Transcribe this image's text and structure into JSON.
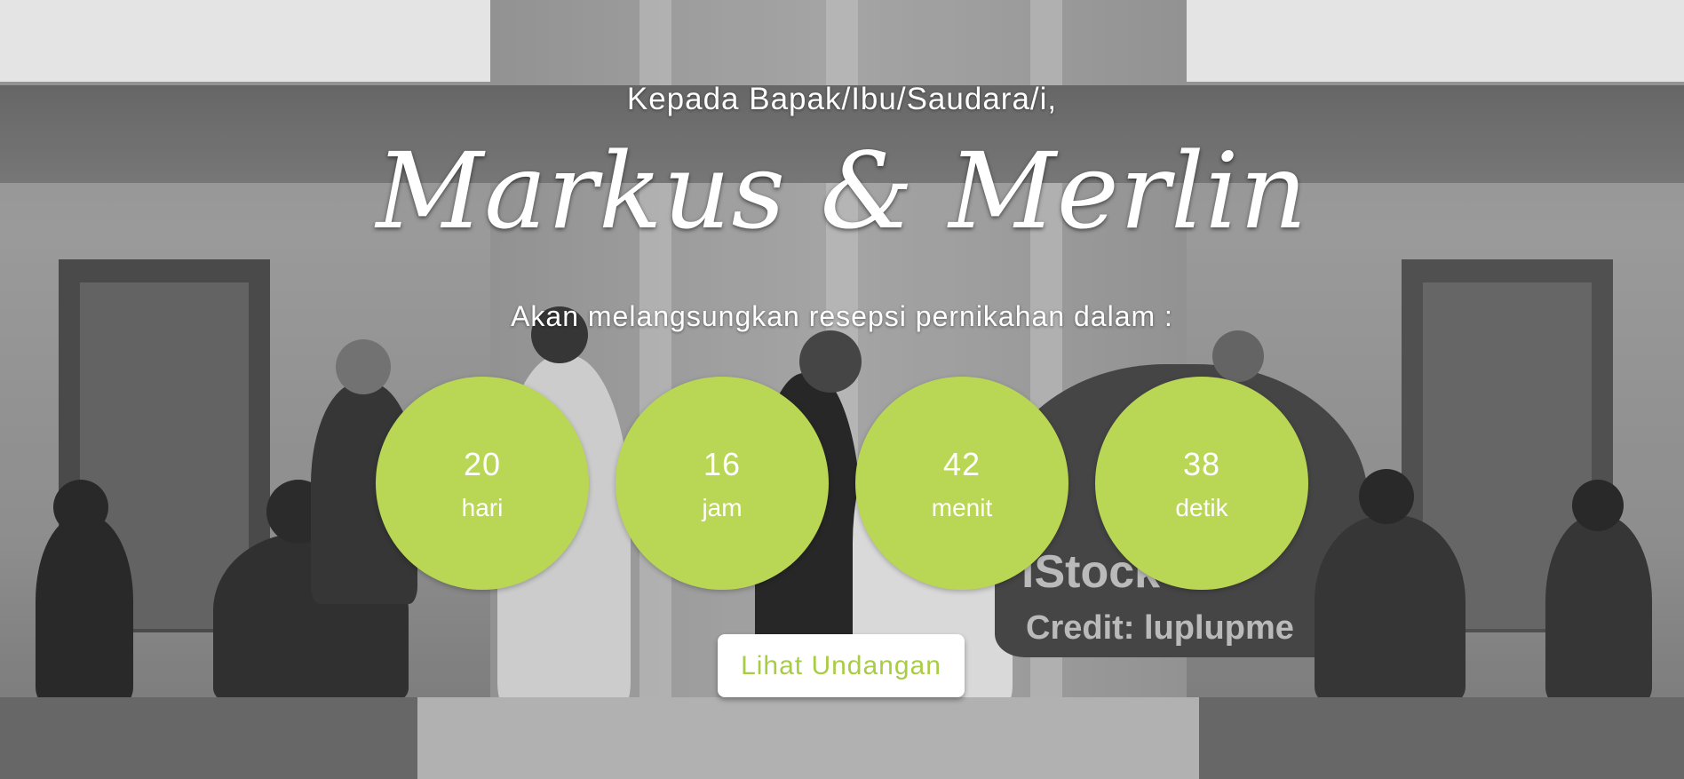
{
  "hero": {
    "greeting": "Kepada Bapak/Ibu/Saudara/i,",
    "couple_names": "Markus & Merlin",
    "subtitle": "Akan melangsungkan resepsi pernikahan dalam :"
  },
  "countdown": [
    {
      "value": "20",
      "unit": "hari"
    },
    {
      "value": "16",
      "unit": "jam"
    },
    {
      "value": "42",
      "unit": "menit"
    },
    {
      "value": "38",
      "unit": "detik"
    }
  ],
  "cta": {
    "label": "Lihat Undangan"
  },
  "background": {
    "watermark_line1": "iStock",
    "watermark_line2": "Credit: luplupme"
  },
  "colors": {
    "accent": "#b9d655",
    "button_text": "#a9cc45",
    "text": "#ffffff"
  }
}
